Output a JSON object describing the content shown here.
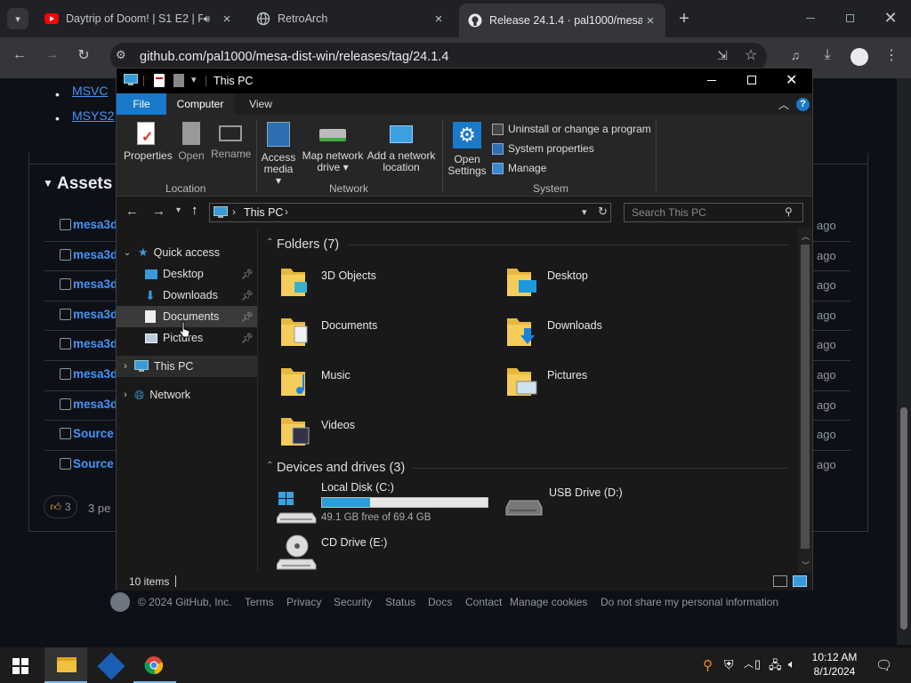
{
  "browser": {
    "tabs": [
      {
        "title": "Daytrip of Doom! | S1 E2 | F",
        "active": false
      },
      {
        "title": "RetroArch",
        "active": false
      },
      {
        "title": "Release 24.1.4 · pal1000/mesa-d",
        "active": true
      }
    ],
    "new_tab": "+",
    "url": "github.com/pal1000/mesa-dist-win/releases/tag/24.1.4"
  },
  "github": {
    "links": [
      "MSVC",
      "MSYS2"
    ],
    "assets_heading": "Assets",
    "assets": [
      {
        "name": "mesa3d",
        "time": "ago"
      },
      {
        "name": "mesa3d",
        "time": "ago"
      },
      {
        "name": "mesa3d",
        "time": "ago"
      },
      {
        "name": "mesa3d",
        "time": "ago"
      },
      {
        "name": "mesa3d",
        "time": "ago"
      },
      {
        "name": "mesa3d",
        "time": "ago"
      },
      {
        "name": "mesa3d",
        "time": "ago"
      },
      {
        "name": "Source",
        "time": "ago"
      },
      {
        "name": "Source",
        "time": "ago"
      }
    ],
    "reaction_count": "3",
    "reaction_text": "3 pe",
    "footer": {
      "copyright": "© 2024 GitHub, Inc.",
      "links": [
        "Terms",
        "Privacy",
        "Security",
        "Status",
        "Docs",
        "Contact",
        "Manage cookies",
        "Do not share my personal information"
      ]
    }
  },
  "explorer": {
    "title": "This PC",
    "ribbon_tabs": [
      "File",
      "Computer",
      "View"
    ],
    "ribbon": {
      "location": {
        "label": "Location",
        "buttons": [
          "Properties",
          "Open",
          "Rename"
        ]
      },
      "network": {
        "label": "Network",
        "buttons": [
          [
            "Access",
            "media ▾"
          ],
          [
            "Map network",
            "drive ▾"
          ],
          [
            "Add a network",
            "location"
          ]
        ]
      },
      "system": {
        "label": "System",
        "open_settings": [
          "Open",
          "Settings"
        ],
        "items": [
          "Uninstall or change a program",
          "System properties",
          "Manage"
        ]
      }
    },
    "address": "This PC",
    "search_placeholder": "Search This PC",
    "nav": {
      "quick_access": "Quick access",
      "pinned": [
        "Desktop",
        "Downloads",
        "Documents",
        "Pictures"
      ],
      "this_pc": "This PC",
      "network": "Network"
    },
    "folders_heading": "Folders (7)",
    "folders": [
      "3D Objects",
      "Desktop",
      "Documents",
      "Downloads",
      "Music",
      "Pictures",
      "Videos"
    ],
    "drives_heading": "Devices and drives (3)",
    "drives": [
      {
        "name": "Local Disk (C:)",
        "free": "49.1 GB free of 69.4 GB",
        "used_fraction": 0.29
      },
      {
        "name": "USB Drive (D:)"
      },
      {
        "name": "CD Drive (E:)"
      }
    ],
    "status": "10 items"
  },
  "taskbar": {
    "time": "10:12 AM",
    "date": "8/1/2024"
  },
  "colors": {
    "accent": "#0078d7",
    "link": "#4493f8",
    "drive_bar": "#26a0da"
  }
}
